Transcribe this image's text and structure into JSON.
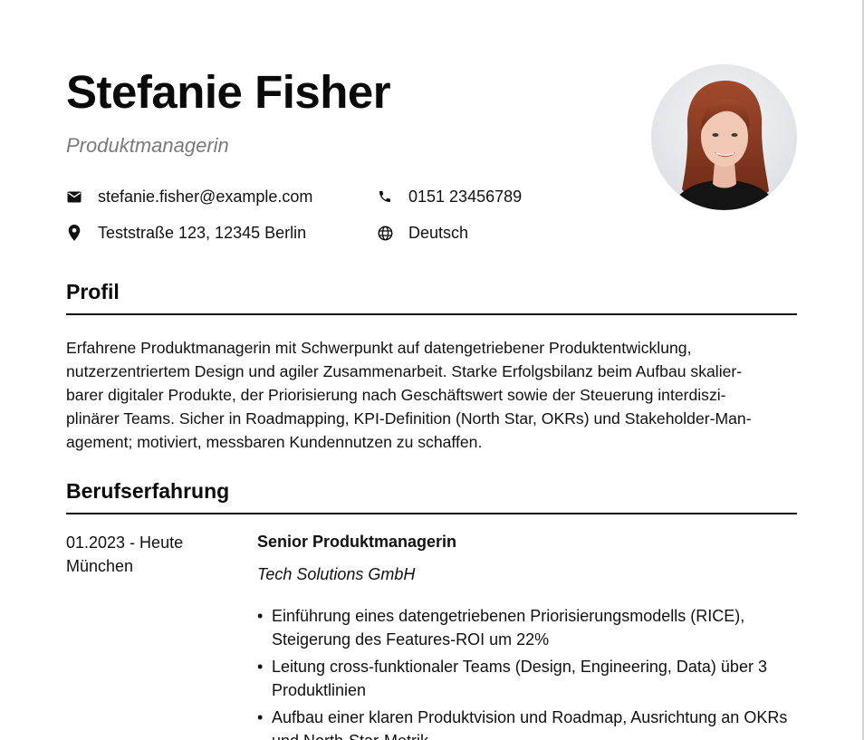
{
  "header": {
    "name": "Stefanie Fisher",
    "title": "Produktmanagerin"
  },
  "contacts": [
    {
      "icon": "email-icon",
      "value": "stefanie.fisher@example.com"
    },
    {
      "icon": "phone-icon",
      "value": "0151 23456789"
    },
    {
      "icon": "location-pin-icon",
      "value": "Teststraße 123, 12345 Berlin"
    },
    {
      "icon": "globe-icon",
      "value": "Deutsch"
    }
  ],
  "sections": {
    "profile_title": "Profil",
    "experience_title": "Berufserfahrung"
  },
  "profile": {
    "lines": [
      "Erfahrene Produktmanagerin mit Schwerpunkt auf datengetriebener Produktentwicklung,",
      "nutzerzentriertem Design und agiler Zusammenarbeit. Starke Erfolgsbilanz beim Aufbau skalier-",
      "barer digitaler Produkte, der Priorisierung nach Geschäftswert sowie der Steuerung interdiszi-",
      "plinärer Teams. Sicher in Roadmapping, KPI-Definition (North Star, OKRs) und Stakeholder-Man-",
      "agement; motiviert, messbaren Kundennutzen zu schaffen."
    ]
  },
  "experience": [
    {
      "date": "01.2023 - Heute",
      "location": "München",
      "role": "Senior Produktmanagerin",
      "company": "Tech Solutions GmbH",
      "bullets": [
        {
          "line1": "Einführung eines datengetriebenen Priorisierungsmodells (RICE),",
          "line2": "Steigerung des Features-ROI um 22%"
        },
        {
          "line1": "Leitung cross-funktionaler Teams (Design, Engineering, Data) über 3",
          "line2": "Produktlinien"
        },
        {
          "line1": "Aufbau einer klaren Produktvision und Roadmap, Ausrichtung an OKRs",
          "line2": "und North-Star-Metrik"
        }
      ]
    }
  ],
  "bullet_char": "•"
}
